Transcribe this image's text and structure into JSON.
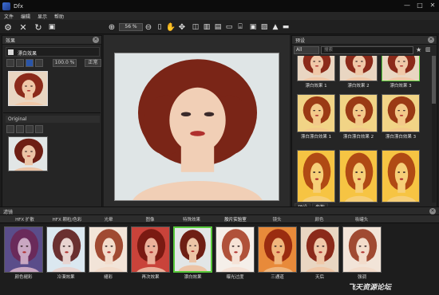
{
  "app": {
    "title": "Dfx"
  },
  "window_controls": [
    "—",
    "□",
    "✕"
  ],
  "menu": [
    "文件",
    "编辑",
    "显示",
    "帮助"
  ],
  "toolbar": {
    "zoom_value": "56 %"
  },
  "effects_panel": {
    "title": "效果",
    "current_effect": "漂白效果",
    "value": "100.0 %",
    "mode": "正常",
    "original_label": "Original"
  },
  "presets_panel": {
    "title": "预设",
    "filter_value": "All",
    "search_placeholder": "搜索",
    "items": [
      "漂白效果 1",
      "漂白效果 2",
      "漂白效果 3",
      "漂白漂白效果 1",
      "漂白漂白效果 2",
      "漂白漂白效果 3",
      "",
      "",
      ""
    ],
    "tabs": [
      "预设",
      "参数"
    ]
  },
  "bottom": {
    "title": "滤镜",
    "categories": [
      "HFX 扩散",
      "HFX 颗粒/色彩",
      "光晕",
      "图像",
      "特殊效果",
      "胶片实验室",
      "镜头",
      "颜色",
      "吸罐头"
    ],
    "thumbs": [
      "颜色褪彩",
      "冷漠效果",
      "褪彩",
      "再次效果",
      "漂白效果",
      "曝光过度",
      "三通道",
      "天后",
      "强调"
    ]
  },
  "watermark": "飞天资源论坛",
  "colors": {
    "accent_green": "#57c93b",
    "panel": "#252525",
    "bg": "#1b1b1b"
  }
}
